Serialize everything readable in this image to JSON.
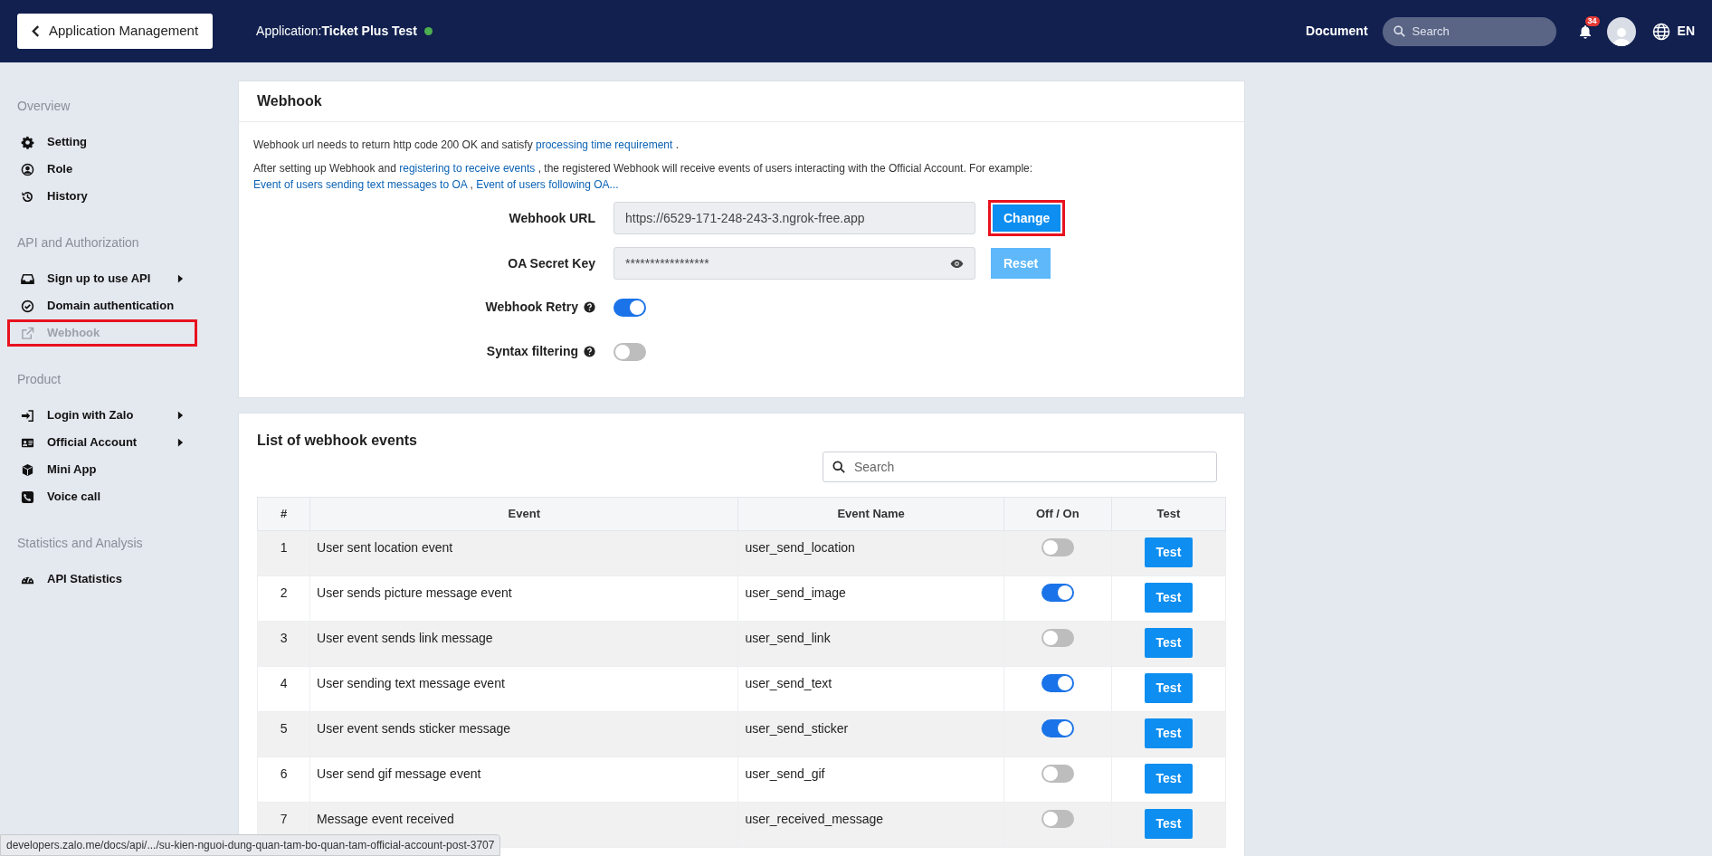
{
  "header": {
    "back_button": "Application Management",
    "app_label": "Application:",
    "app_name": "Ticket Plus Test",
    "app_online": true,
    "document_link": "Document",
    "search_placeholder": "Search",
    "notification_count": "34",
    "language": "EN"
  },
  "sidebar": {
    "sections": [
      {
        "title": "Overview",
        "items": [
          {
            "kind": "gear",
            "label": "Setting",
            "has_submenu": false,
            "selected": false,
            "highlighted": false
          },
          {
            "kind": "user",
            "label": "Role",
            "has_submenu": false,
            "selected": false,
            "highlighted": false
          },
          {
            "kind": "history",
            "label": "History",
            "has_submenu": false,
            "selected": false,
            "highlighted": false
          }
        ]
      },
      {
        "title": "API and Authorization",
        "items": [
          {
            "kind": "inbox",
            "label": "Sign up to use API",
            "has_submenu": true,
            "selected": false,
            "highlighted": false
          },
          {
            "kind": "check",
            "label": "Domain authentication",
            "has_submenu": false,
            "selected": false,
            "highlighted": false
          },
          {
            "kind": "external",
            "label": "Webhook",
            "has_submenu": false,
            "selected": true,
            "highlighted": true
          }
        ]
      },
      {
        "title": "Product",
        "items": [
          {
            "kind": "login",
            "label": "Login with Zalo",
            "has_submenu": true,
            "selected": false,
            "highlighted": false
          },
          {
            "kind": "card",
            "label": "Official Account",
            "has_submenu": true,
            "selected": false,
            "highlighted": false
          },
          {
            "kind": "cube",
            "label": "Mini App",
            "has_submenu": false,
            "selected": false,
            "highlighted": false
          },
          {
            "kind": "phone",
            "label": "Voice call",
            "has_submenu": false,
            "selected": false,
            "highlighted": false
          }
        ]
      },
      {
        "title": "Statistics and Analysis",
        "items": [
          {
            "kind": "gauge",
            "label": "API Statistics",
            "has_submenu": false,
            "selected": false,
            "highlighted": false
          }
        ]
      }
    ]
  },
  "webhook": {
    "title": "Webhook",
    "paragraphs": [
      [
        {
          "text": "Webhook url needs to return http code 200 OK and satisfy ",
          "kind": "plain"
        },
        {
          "text": "processing time requirement",
          "kind": "link"
        },
        {
          "text": " .",
          "kind": "plain"
        }
      ],
      [
        {
          "text": "After setting up Webhook and ",
          "kind": "plain"
        },
        {
          "text": "registering to receive events",
          "kind": "link"
        },
        {
          "text": " , the registered Webhook will receive events of users interacting with the Official Account. For example: ",
          "kind": "plain"
        },
        {
          "text": "Event of users sending text messages to OA",
          "kind": "link"
        },
        {
          "text": " , ",
          "kind": "plain"
        },
        {
          "text": "Event of users following OA...",
          "kind": "link"
        }
      ]
    ],
    "fields": [
      {
        "kind": "text",
        "label": "Webhook URL",
        "value": "https://6529-171-248-243-3.ngrok-free.app",
        "button": "Change",
        "button_disabled": false,
        "highlighted": true
      },
      {
        "kind": "secret",
        "label": "OA Secret Key",
        "value": "*****************",
        "button": "Reset",
        "button_disabled": true,
        "highlighted": false
      },
      {
        "kind": "toggle",
        "label": "Webhook Retry",
        "on": true
      },
      {
        "kind": "toggle",
        "label": "Syntax filtering",
        "on": false
      }
    ]
  },
  "events": {
    "title": "List of webhook events",
    "search_placeholder": "Search",
    "columns": [
      "#",
      "Event",
      "Event Name",
      "Off / On",
      "Test"
    ],
    "rows": [
      {
        "number": "1",
        "event": "User sent location event",
        "event_name": "user_send_location",
        "on": false,
        "button": "Test"
      },
      {
        "number": "2",
        "event": "User sends picture message event",
        "event_name": "user_send_image",
        "on": true,
        "button": "Test"
      },
      {
        "number": "3",
        "event": "User event sends link message",
        "event_name": "user_send_link",
        "on": false,
        "button": "Test"
      },
      {
        "number": "4",
        "event": "User sending text message event",
        "event_name": "user_send_text",
        "on": true,
        "button": "Test"
      },
      {
        "number": "5",
        "event": "User event sends sticker message",
        "event_name": "user_send_sticker",
        "on": true,
        "button": "Test"
      },
      {
        "number": "6",
        "event": "User send gif message event",
        "event_name": "user_send_gif",
        "on": false,
        "button": "Test"
      },
      {
        "number": "7",
        "event": "Message event received",
        "event_name": "user_received_message",
        "on": false,
        "button": "Test"
      }
    ]
  },
  "status_bar": {
    "url": "developers.zalo.me/docs/api/.../su-kien-nguoi-dung-quan-tam-bo-quan-tam-official-account-post-3707"
  }
}
